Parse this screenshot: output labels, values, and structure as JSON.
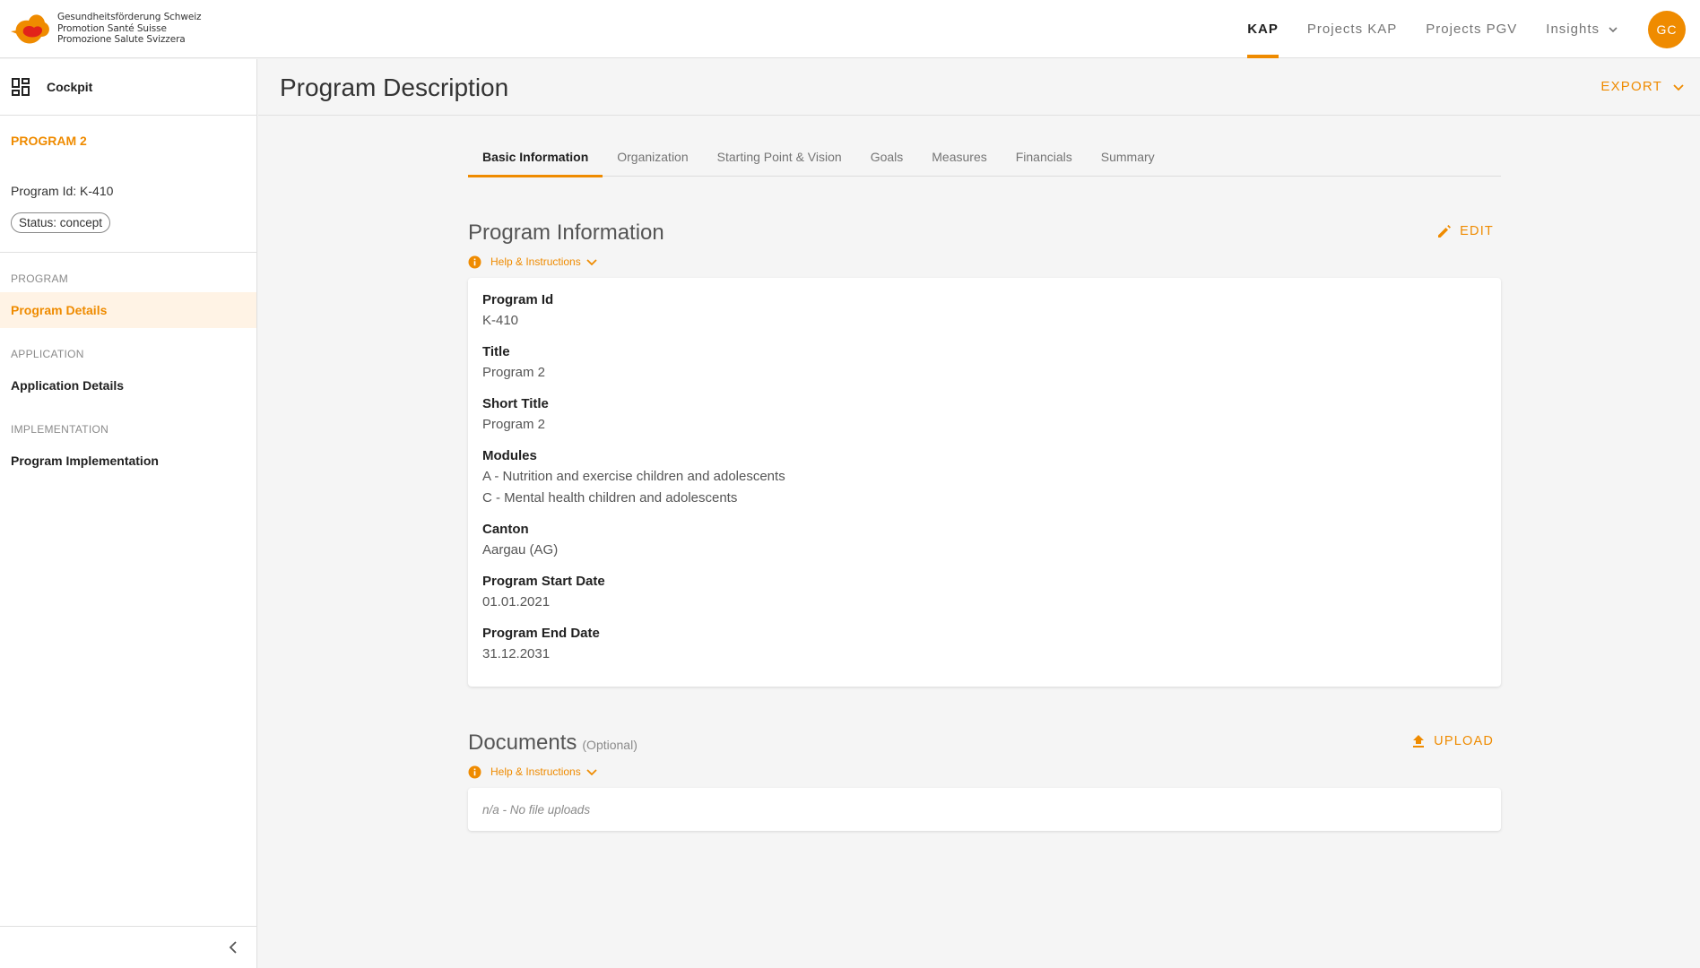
{
  "brand": {
    "logo_lines": [
      "Gesundheitsförderung Schweiz",
      "Promotion Santé Suisse",
      "Promozione Salute Svizzera"
    ],
    "accent_color": "#ef8b00"
  },
  "nav": {
    "items": [
      {
        "label": "KAP",
        "active": true
      },
      {
        "label": "Projects KAP"
      },
      {
        "label": "Projects PGV"
      },
      {
        "label": "Insights",
        "has_dropdown": true
      }
    ],
    "avatar_initials": "GC"
  },
  "sidebar": {
    "cockpit_label": "Cockpit",
    "program_name": "PROGRAM 2",
    "program_id": "Program Id: K-410",
    "status": "Status: concept",
    "sections": [
      {
        "label": "PROGRAM",
        "item": "Program Details"
      },
      {
        "label": "APPLICATION",
        "item": "Application Details"
      },
      {
        "label": "IMPLEMENTATION",
        "item": "Program Implementation"
      }
    ]
  },
  "header": {
    "title": "Program Description",
    "export_label": "EXPORT"
  },
  "tabs": [
    "Basic Information",
    "Organization",
    "Starting Point & Vision",
    "Goals",
    "Measures",
    "Financials",
    "Summary"
  ],
  "program_info": {
    "title": "Program Information",
    "edit_label": "EDIT",
    "help_label": "Help & Instructions",
    "fields": [
      {
        "label": "Program Id",
        "values": [
          "K-410"
        ]
      },
      {
        "label": "Title",
        "values": [
          "Program 2"
        ]
      },
      {
        "label": "Short Title",
        "values": [
          "Program 2"
        ]
      },
      {
        "label": "Modules",
        "values": [
          "A - Nutrition and exercise children and adolescents",
          "C - Mental health children and adolescents"
        ]
      },
      {
        "label": "Canton",
        "values": [
          "Aargau (AG)"
        ]
      },
      {
        "label": "Program Start Date",
        "values": [
          "01.01.2021"
        ]
      },
      {
        "label": "Program End Date",
        "values": [
          "31.12.2031"
        ]
      }
    ]
  },
  "documents": {
    "title": "Documents",
    "optional": "(Optional)",
    "upload_label": "UPLOAD",
    "help_label": "Help & Instructions",
    "empty_text": "n/a - No file uploads"
  }
}
